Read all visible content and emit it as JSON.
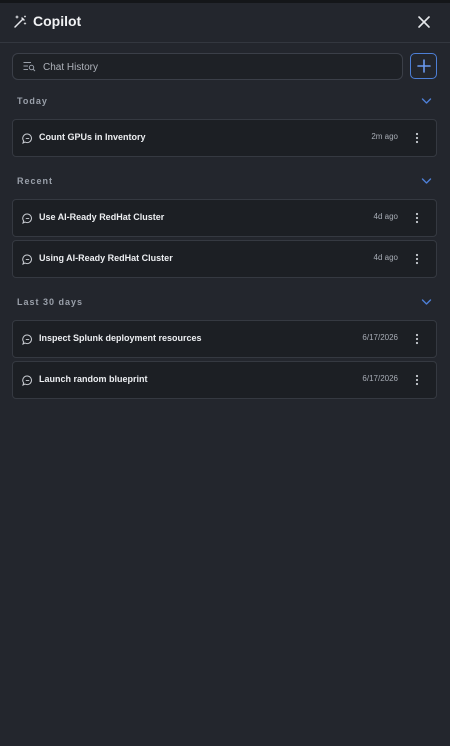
{
  "header": {
    "title": "Copilot"
  },
  "search": {
    "placeholder": "Chat History"
  },
  "sections": [
    {
      "label": "Today",
      "items": [
        {
          "title": "Count GPUs in Inventory",
          "time": "2m ago"
        }
      ]
    },
    {
      "label": "Recent",
      "items": [
        {
          "title": "Use AI-Ready RedHat Cluster",
          "time": "4d ago"
        },
        {
          "title": "Using AI-Ready RedHat Cluster",
          "time": "4d ago"
        }
      ]
    },
    {
      "label": "Last 30 days",
      "items": [
        {
          "title": "Inspect Splunk deployment resources",
          "time": "6/17/2026"
        },
        {
          "title": "Launch random blueprint",
          "time": "6/17/2026"
        }
      ]
    }
  ],
  "icons": {
    "header": [
      "magic-wand-icon",
      "close-icon"
    ],
    "search": "search-list-icon",
    "add": "plus-icon",
    "section_toggle": "chevron-down-icon",
    "item": [
      "chat-bubble-icon",
      "kebab-menu-icon"
    ]
  },
  "colors": {
    "accent": "#4d7fd6",
    "background": "#23262d",
    "card": "#1c1f24"
  }
}
